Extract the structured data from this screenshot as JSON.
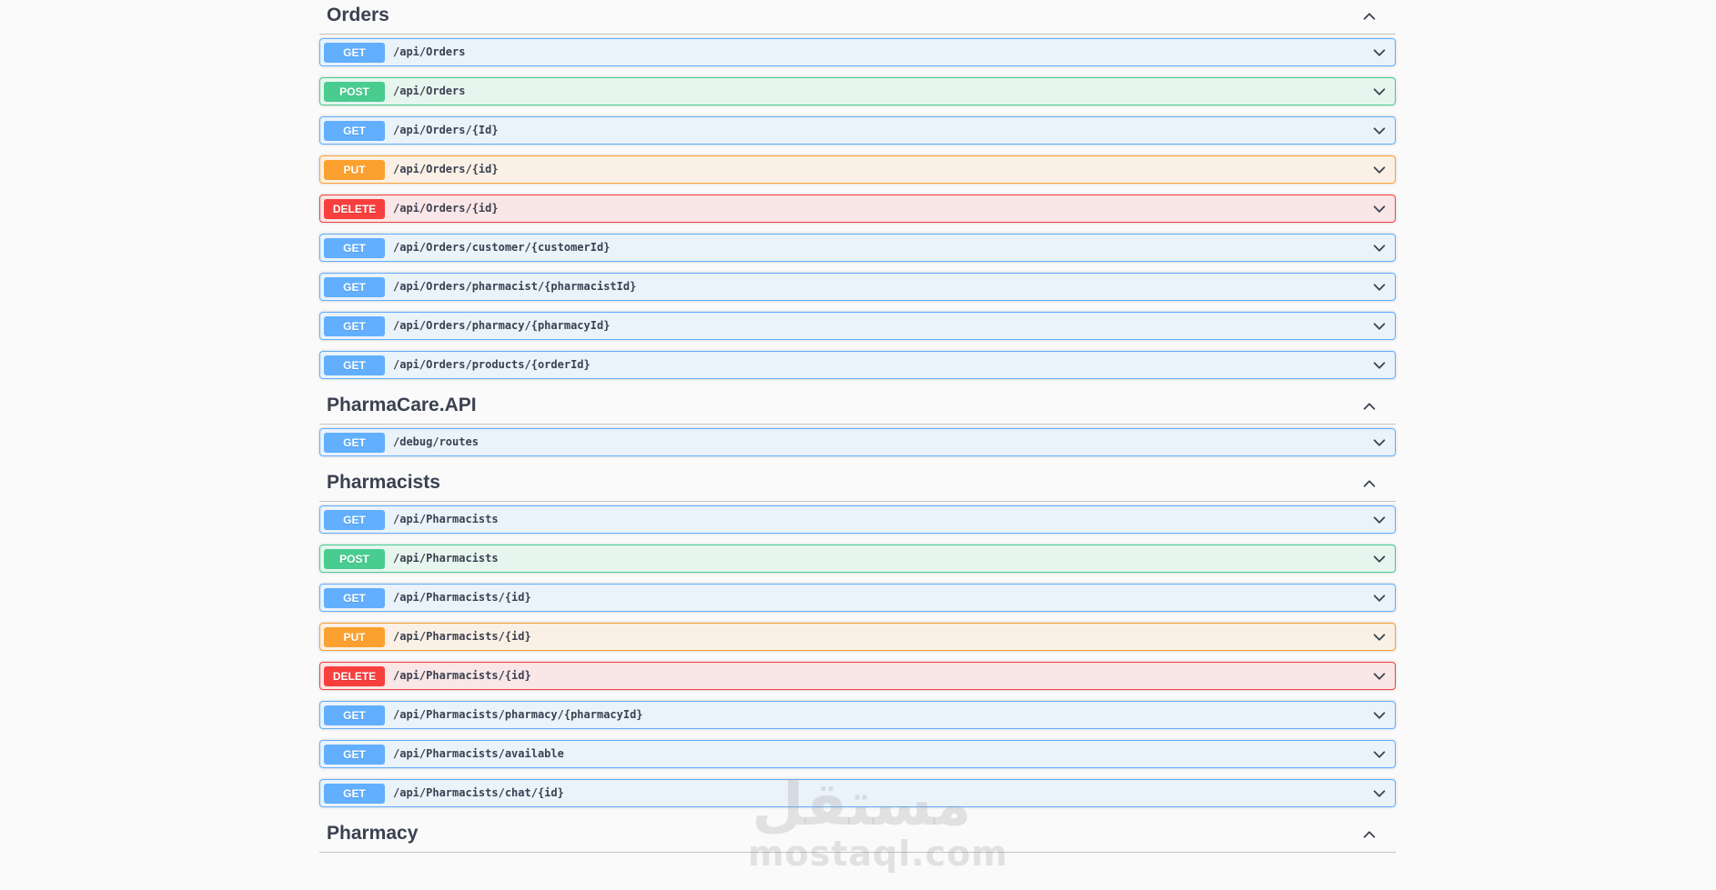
{
  "sections": [
    {
      "title": "Orders",
      "operations": [
        {
          "method": "GET",
          "path": "/api/Orders"
        },
        {
          "method": "POST",
          "path": "/api/Orders"
        },
        {
          "method": "GET",
          "path": "/api/Orders/{Id}"
        },
        {
          "method": "PUT",
          "path": "/api/Orders/{id}"
        },
        {
          "method": "DELETE",
          "path": "/api/Orders/{id}"
        },
        {
          "method": "GET",
          "path": "/api/Orders/customer/{customerId}"
        },
        {
          "method": "GET",
          "path": "/api/Orders/pharmacist/{pharmacistId}"
        },
        {
          "method": "GET",
          "path": "/api/Orders/pharmacy/{pharmacyId}"
        },
        {
          "method": "GET",
          "path": "/api/Orders/products/{orderId}"
        }
      ]
    },
    {
      "title": "PharmaCare.API",
      "operations": [
        {
          "method": "GET",
          "path": "/debug/routes"
        }
      ]
    },
    {
      "title": "Pharmacists",
      "operations": [
        {
          "method": "GET",
          "path": "/api/Pharmacists"
        },
        {
          "method": "POST",
          "path": "/api/Pharmacists"
        },
        {
          "method": "GET",
          "path": "/api/Pharmacists/{id}"
        },
        {
          "method": "PUT",
          "path": "/api/Pharmacists/{id}"
        },
        {
          "method": "DELETE",
          "path": "/api/Pharmacists/{id}"
        },
        {
          "method": "GET",
          "path": "/api/Pharmacists/pharmacy/{pharmacyId}"
        },
        {
          "method": "GET",
          "path": "/api/Pharmacists/available"
        },
        {
          "method": "GET",
          "path": "/api/Pharmacists/chat/{id}"
        }
      ]
    },
    {
      "title": "Pharmacy",
      "operations": []
    }
  ],
  "icons": {
    "section_toggle": "chevron-up-icon",
    "operation_expand": "chevron-down-icon"
  },
  "colors": {
    "get": "#61affe",
    "post": "#49cc90",
    "put": "#fca130",
    "delete": "#f93e3e"
  },
  "watermark": {
    "arabic": "مستقل",
    "latin": "mostaql.com"
  }
}
